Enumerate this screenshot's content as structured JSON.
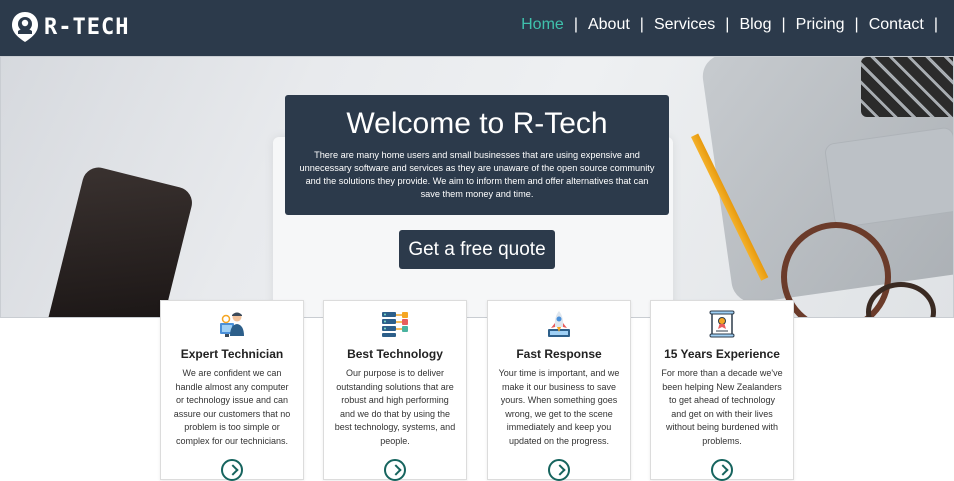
{
  "brand": {
    "name": "R-TECH"
  },
  "nav": {
    "items": [
      {
        "label": "Home",
        "active": true
      },
      {
        "label": "About",
        "active": false
      },
      {
        "label": "Services",
        "active": false
      },
      {
        "label": "Blog",
        "active": false
      },
      {
        "label": "Pricing",
        "active": false
      },
      {
        "label": "Contact",
        "active": false
      }
    ],
    "separator": "|"
  },
  "hero": {
    "title": "Welcome to R-Tech",
    "text": "There are many home users and small businesses that are using expensive and unnecessary software and services as they are unaware of the open source community and the solutions they provide. We aim to inform them and offer alternatives that can save them money and time.",
    "cta_label": "Get a free quote"
  },
  "features": [
    {
      "title": "Expert Technician",
      "icon": "technician-icon",
      "text": "We are confident we can handle almost any computer or technology issue and can assure our customers that no problem is too simple or complex for our technicians."
    },
    {
      "title": "Best Technology",
      "icon": "server-network-icon",
      "text": "Our purpose is to deliver outstanding solutions that are robust and high performing and we do that by using the best technology, systems, and people."
    },
    {
      "title": "Fast Response",
      "icon": "rocket-icon",
      "text": "Your time is important, and we make it our business to save yours. When something goes wrong, we get to the scene immediately and keep you updated on the progress."
    },
    {
      "title": "15 Years Experience",
      "icon": "certificate-icon",
      "text": "For more than a decade we've been helping New Zealanders to get ahead of technology and get on with their lives without being burdened with problems."
    }
  ],
  "colors": {
    "nav_bg": "#2c3a4b",
    "accent": "#3fc1ac",
    "more_icon": "#16645e"
  }
}
